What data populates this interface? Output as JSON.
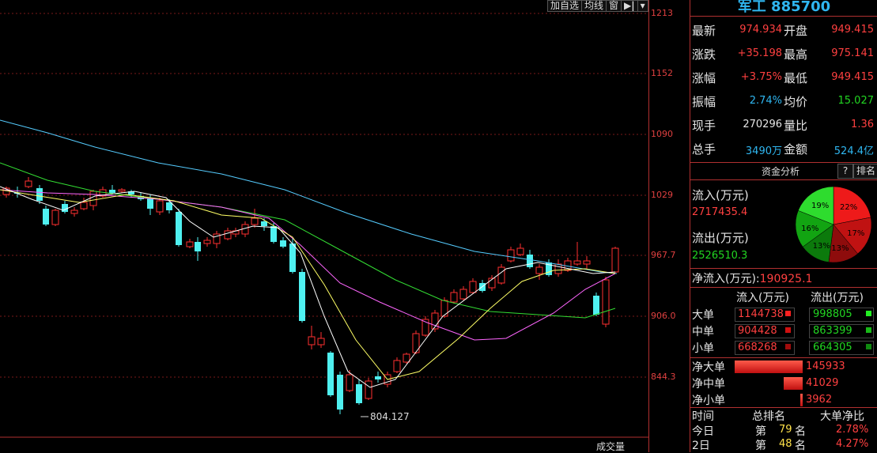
{
  "toolbar": {
    "btn_watchlist": "加自选",
    "btn_ma": "均线",
    "btn_window": "窗"
  },
  "chart": {
    "y_ticks": [
      "1213",
      "1152",
      "1090",
      "1029",
      "967.7",
      "906.0",
      "844.3"
    ],
    "min_label": "804.127",
    "volume_label": "成交量",
    "colors": {
      "up": "#ff3030",
      "down": "#4ff0f0",
      "ma5": "#ffffff",
      "ma10": "#ffff66",
      "ma20": "#ff66ff",
      "ma30": "#33dd33",
      "ma60": "#55ccff"
    }
  },
  "panel": {
    "title": "军工 885700",
    "quote": [
      {
        "label_l": "最新",
        "val_l": "974.934",
        "label_r": "开盘",
        "val_r": "949.415"
      },
      {
        "label_l": "涨跌",
        "val_l": "+35.198",
        "label_r": "最高",
        "val_r": "975.141"
      },
      {
        "label_l": "涨幅",
        "val_l": "+3.75%",
        "label_r": "最低",
        "val_r": "949.415"
      },
      {
        "label_l": "振幅",
        "val_l": "2.74%",
        "label_r": "均价",
        "val_r": "15.027"
      },
      {
        "label_l": "现手",
        "val_l": "270296",
        "label_r": "量比",
        "val_r": "1.36"
      },
      {
        "label_l": "总手",
        "val_l": "3490万",
        "label_r": "金额",
        "val_r": "524.4亿"
      }
    ],
    "funds": {
      "title": "资金分析",
      "help": "?",
      "rank": "排名",
      "inflow_label": "流入(万元)",
      "inflow_value": "2717435.4",
      "outflow_label": "流出(万元)",
      "outflow_value": "2526510.3",
      "pie": [
        {
          "label": "22%",
          "value": 22,
          "color": "#ee1a1a"
        },
        {
          "label": "17%",
          "value": 17,
          "color": "#c01212"
        },
        {
          "label": "13%",
          "value": 13,
          "color": "#8e0c0c"
        },
        {
          "label": "13%",
          "value": 13,
          "color": "#0c7a0c"
        },
        {
          "label": "16%",
          "value": 16,
          "color": "#12a412"
        },
        {
          "label": "19%",
          "value": 19,
          "color": "#2edc2e"
        }
      ],
      "net_label": "净流入(万元):",
      "net_value": "190925.1",
      "table_head_in": "流入(万元)",
      "table_head_out": "流出(万元)",
      "rows": [
        {
          "name": "大单",
          "in": "1144738",
          "out": "998805"
        },
        {
          "name": "中单",
          "in": "904428",
          "out": "863399"
        },
        {
          "name": "小单",
          "in": "668268",
          "out": "664305"
        }
      ],
      "net_rows": [
        {
          "name": "净大单",
          "value": "145933",
          "ratio": 1.0
        },
        {
          "name": "净中单",
          "value": "41029",
          "ratio": 0.28
        },
        {
          "name": "净小单",
          "value": "3962",
          "ratio": 0.03
        }
      ],
      "rank_head": {
        "time": "时间",
        "total": "总排名",
        "big": "大单净比"
      },
      "rank_rows": [
        {
          "time": "今日",
          "prefix": "第",
          "rank": "79",
          "suffix": "名",
          "ratio": "2.78%"
        },
        {
          "time": "2日",
          "prefix": "第",
          "rank": "48",
          "suffix": "名",
          "ratio": "4.27%"
        }
      ]
    }
  }
}
